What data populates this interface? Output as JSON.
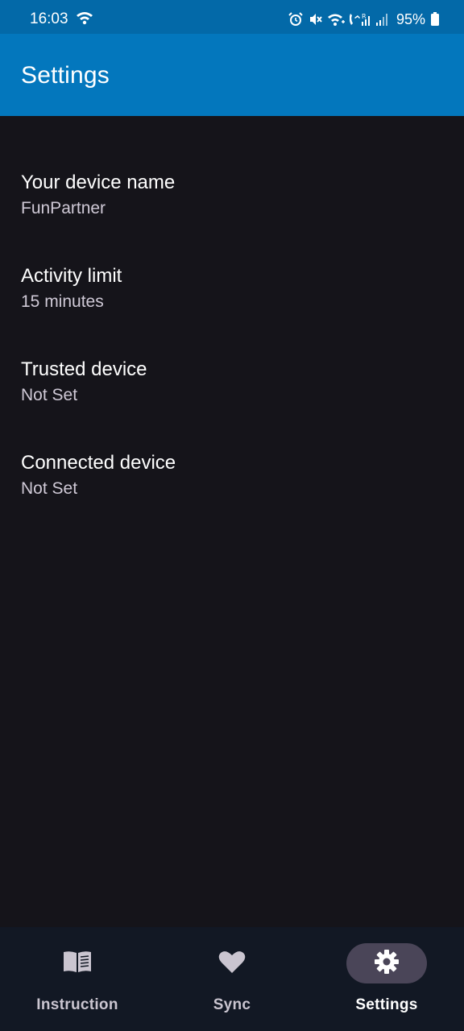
{
  "status_bar": {
    "time": "16:03",
    "battery": "95%",
    "icons": [
      "wifi-icon",
      "alarm-icon",
      "mute-icon",
      "wifi-calling-icon",
      "roaming-signal-icon",
      "signal-icon",
      "battery-icon"
    ]
  },
  "app_bar": {
    "title": "Settings"
  },
  "settings": {
    "items": [
      {
        "title": "Your device name",
        "value": "FunPartner"
      },
      {
        "title": "Activity limit",
        "value": "15 minutes"
      },
      {
        "title": "Trusted device",
        "value": "Not Set"
      },
      {
        "title": "Connected device",
        "value": "Not Set"
      }
    ]
  },
  "bottom_nav": {
    "items": [
      {
        "label": "Instruction",
        "icon": "book-icon",
        "active": false
      },
      {
        "label": "Sync",
        "icon": "heart-icon",
        "active": false
      },
      {
        "label": "Settings",
        "icon": "gear-icon",
        "active": true
      }
    ]
  },
  "colors": {
    "status_bar": "#0369a8",
    "app_bar": "#0377bd",
    "background": "#15141a",
    "bottom_nav": "#121824",
    "active_indicator": "#4a4558",
    "secondary_text": "#cfc9d6"
  }
}
